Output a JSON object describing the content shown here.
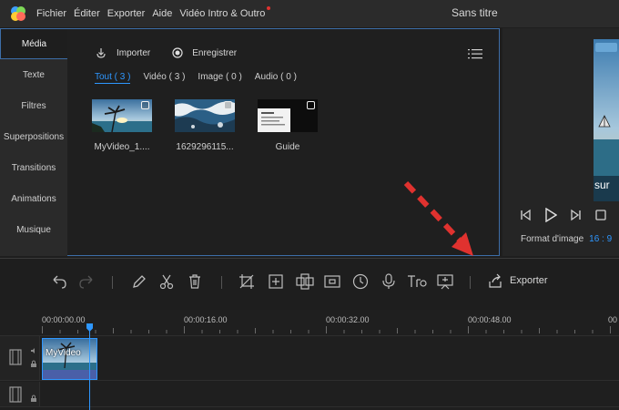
{
  "menubar": {
    "items": [
      "Fichier",
      "Éditer",
      "Exporter",
      "Aide",
      "Vidéo Intro & Outro"
    ],
    "window_title": "Sans titre"
  },
  "sidebar": {
    "items": [
      "Média",
      "Texte",
      "Filtres",
      "Superpositions",
      "Transitions",
      "Animations",
      "Musique"
    ],
    "active": "Média"
  },
  "media": {
    "import_label": "Importer",
    "record_label": "Enregistrer",
    "tabs": [
      "Tout ( 3 )",
      "Vidéo ( 3 )",
      "Image ( 0 )",
      "Audio ( 0 )"
    ],
    "active_tab": "Tout ( 3 )",
    "clips": [
      {
        "name": "MyVideo_1....",
        "icon": "beach-palm-thumbnail"
      },
      {
        "name": "1629296115...",
        "icon": "seashore-waves-thumbnail"
      },
      {
        "name": "Guide",
        "icon": "dark-guide-thumbnail"
      }
    ]
  },
  "preview": {
    "aspect_label": "Format d'image",
    "aspect_value": "16 : 9",
    "overlay_text": "sur"
  },
  "toolbar": {
    "export_label": "Exporter"
  },
  "timeline": {
    "timecodes": [
      "00:00:00.00",
      "00:00:16.00",
      "00:00:32.00",
      "00:00:48.00",
      "00"
    ],
    "clip_label": "MyVideo"
  },
  "colors": {
    "accent": "#2e97ff",
    "annotation": "#e0322f",
    "panel_border": "#3d6ea8"
  }
}
